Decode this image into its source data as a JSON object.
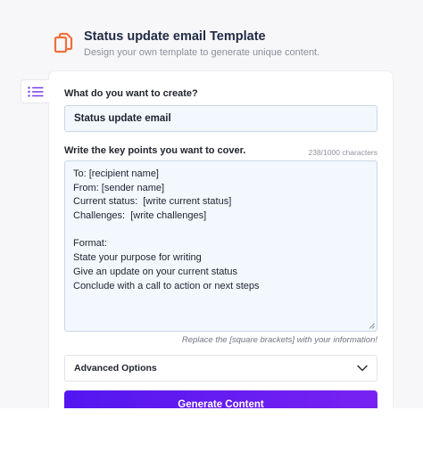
{
  "header": {
    "title": "Status update email Template",
    "subtitle": "Design your own template to generate unique content.",
    "icon": "copy-document-icon",
    "icon_color": "#f06f3c"
  },
  "sidebar_toggle": {
    "icon": "list-icon",
    "color": "#7c3aed"
  },
  "form": {
    "create_label": "What do you want to create?",
    "create_value": "Status update email",
    "keypoints_label": "Write the key points you want to cover.",
    "char_counter": "238/1000 characters",
    "keypoints_lines": [
      "To: [recipient name]",
      "From: [sender name]",
      "Current status:  [write current status]",
      "Challenges:  [write challenges]",
      "",
      "Format:",
      "State your purpose for writing",
      "Give an update on your current status",
      "Conclude with a call to action or next steps"
    ],
    "hint": "Replace the [square brackets] with your information!",
    "advanced_label": "Advanced Options",
    "generate_label": "Generate Content"
  },
  "colors": {
    "accent_start": "#5316f0",
    "accent_end": "#7822f2",
    "field_bg": "#f3f8fe"
  }
}
